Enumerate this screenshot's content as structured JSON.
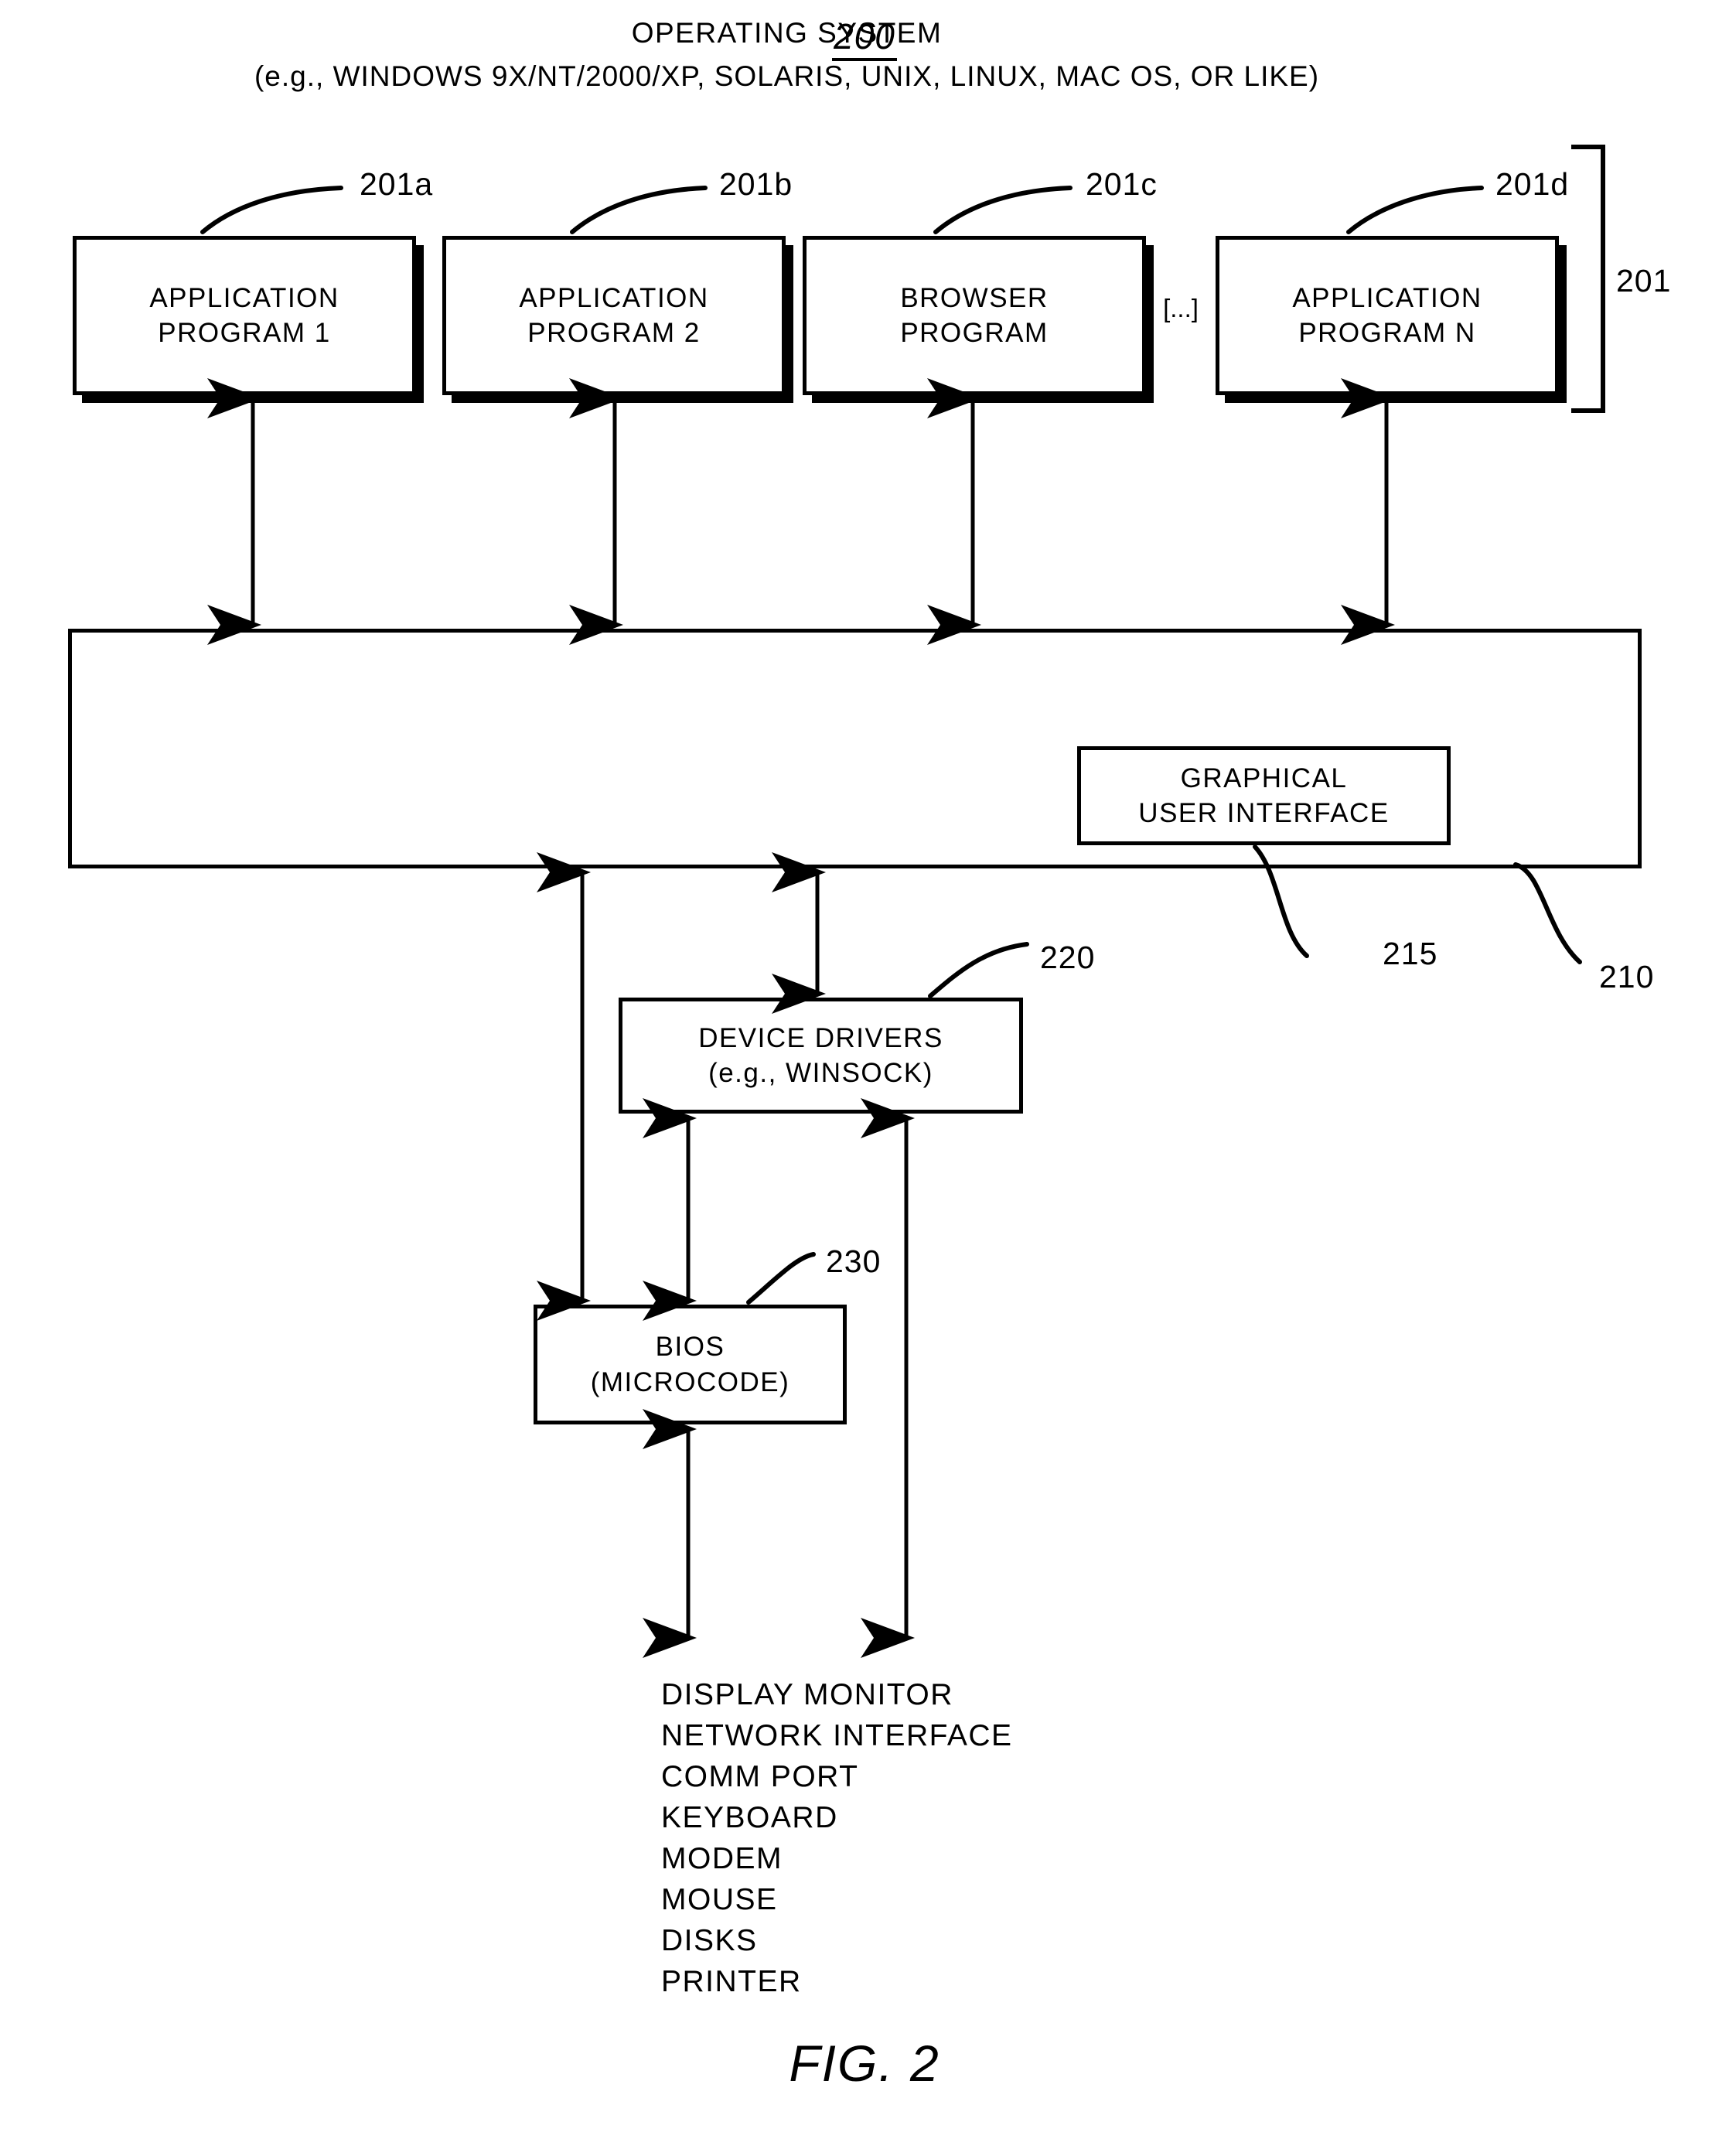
{
  "figure": {
    "number": "200",
    "caption": "FIG. 2"
  },
  "application_layer": {
    "group_ref": "201",
    "ellipsis": "[...]",
    "programs": [
      {
        "ref": "201a",
        "line1": "APPLICATION",
        "line2": "PROGRAM 1"
      },
      {
        "ref": "201b",
        "line1": "APPLICATION",
        "line2": "PROGRAM 2"
      },
      {
        "ref": "201c",
        "line1": "BROWSER",
        "line2": "PROGRAM"
      },
      {
        "ref": "201d",
        "line1": "APPLICATION",
        "line2": "PROGRAM N"
      }
    ]
  },
  "operating_system": {
    "ref": "210",
    "title": "OPERATING SYSTEM",
    "subtitle": "(e.g., WINDOWS 9X/NT/2000/XP, SOLARIS, UNIX, LINUX, MAC OS, OR LIKE)",
    "gui": {
      "ref": "215",
      "line1": "GRAPHICAL",
      "line2": "USER INTERFACE"
    }
  },
  "device_drivers": {
    "ref": "220",
    "line1": "DEVICE DRIVERS",
    "line2": "(e.g., WINSOCK)"
  },
  "bios": {
    "ref": "230",
    "line1": "BIOS",
    "line2": "(MICROCODE)"
  },
  "peripherals": [
    "DISPLAY MONITOR",
    "NETWORK INTERFACE",
    "COMM PORT",
    "KEYBOARD",
    "MODEM",
    "MOUSE",
    "DISKS",
    "PRINTER"
  ],
  "colors": {
    "ink": "#000000",
    "paper": "#ffffff"
  }
}
